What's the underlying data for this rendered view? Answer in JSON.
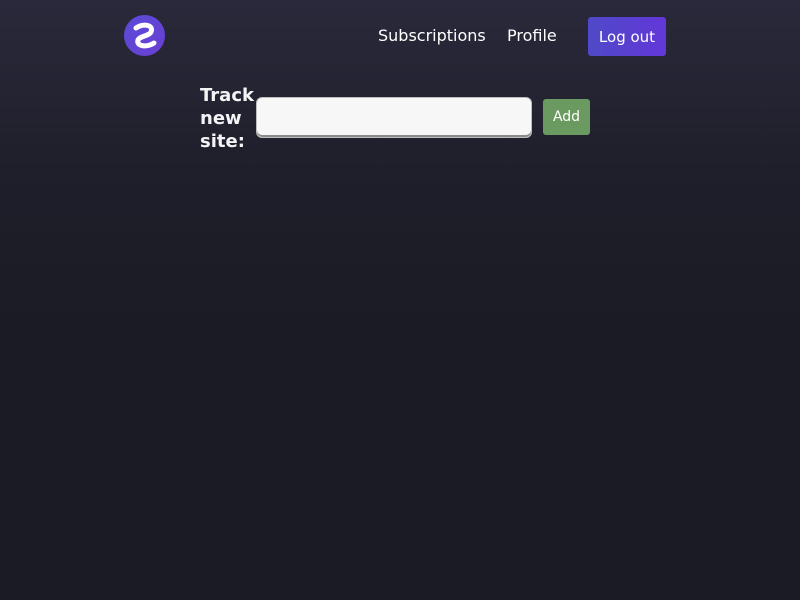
{
  "nav": {
    "logo_icon": "app-logo-icon",
    "links": [
      {
        "label": "Subscriptions"
      },
      {
        "label": "Profile"
      }
    ],
    "logout_label": "Log out"
  },
  "track_form": {
    "label": "Track new site:",
    "input_value": "",
    "input_placeholder": "",
    "add_label": "Add"
  },
  "colors": {
    "background": "#1b1b25",
    "logout_button_start": "#4f49c7",
    "logout_button_end": "#6337d9",
    "add_button": "#6a9a5f",
    "input_background": "#f7f7f7"
  }
}
